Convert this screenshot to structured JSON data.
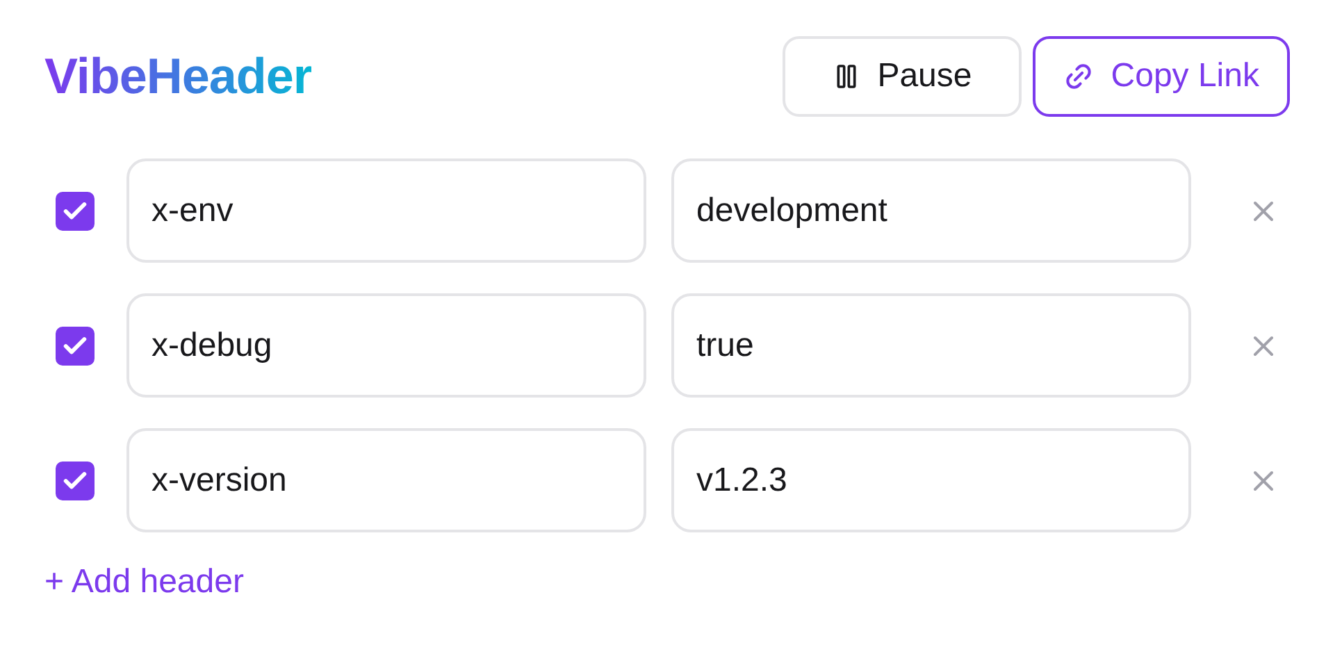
{
  "title": "VibeHeader",
  "actions": [
    {
      "label": "Pause",
      "kind": "pause"
    },
    {
      "label": "Copy Link",
      "kind": "link"
    }
  ],
  "headers": [
    {
      "checked": true,
      "name": "x-env",
      "value": "development"
    },
    {
      "checked": true,
      "name": "x-debug",
      "value": "true"
    },
    {
      "checked": true,
      "name": "x-version",
      "value": "v1.2.3"
    }
  ],
  "add_link": "+ Add header"
}
